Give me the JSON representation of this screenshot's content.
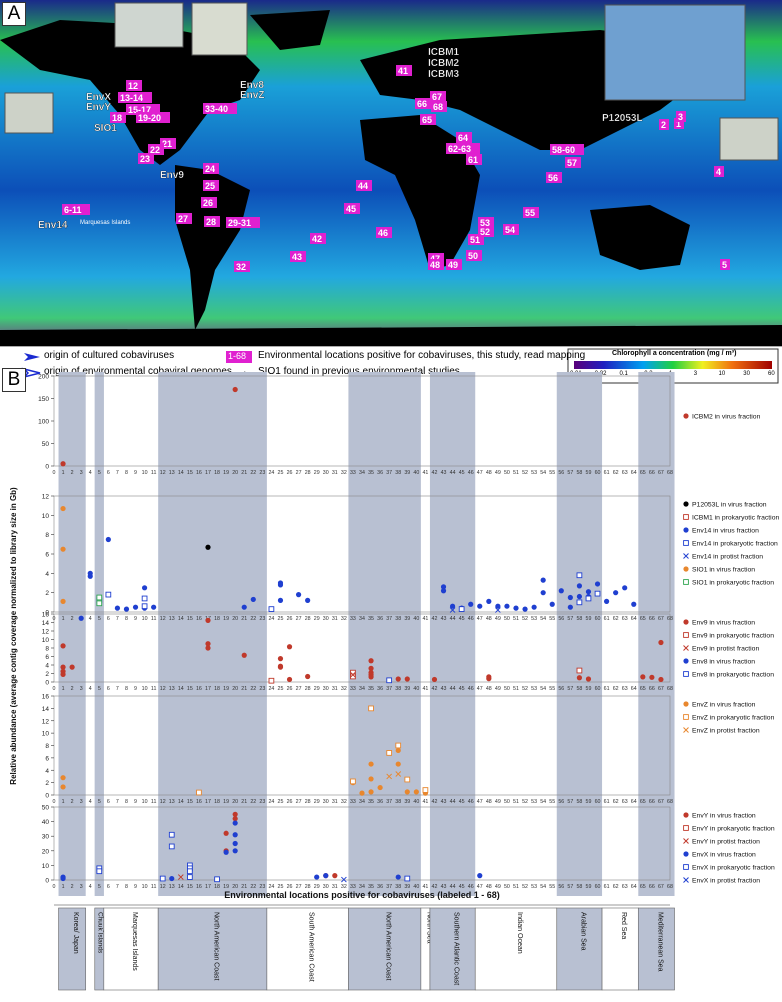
{
  "panel_a": {
    "letter": "A",
    "marine_islands_label": "Marquesas Islands",
    "site_labels": [
      {
        "text": "12"
      },
      {
        "text": "13-14"
      },
      {
        "text": "15-17"
      },
      {
        "text": "18"
      },
      {
        "text": "19-20"
      },
      {
        "text": "21"
      },
      {
        "text": "22"
      },
      {
        "text": "23"
      },
      {
        "text": "24"
      },
      {
        "text": "25"
      },
      {
        "text": "26"
      },
      {
        "text": "27"
      },
      {
        "text": "28"
      },
      {
        "text": "29-31"
      },
      {
        "text": "32"
      },
      {
        "text": "33-40"
      },
      {
        "text": "41"
      },
      {
        "text": "42"
      },
      {
        "text": "43"
      },
      {
        "text": "44"
      },
      {
        "text": "45"
      },
      {
        "text": "46"
      },
      {
        "text": "47"
      },
      {
        "text": "48"
      },
      {
        "text": "49"
      },
      {
        "text": "50"
      },
      {
        "text": "51"
      },
      {
        "text": "52"
      },
      {
        "text": "53"
      },
      {
        "text": "54"
      },
      {
        "text": "55"
      },
      {
        "text": "56"
      },
      {
        "text": "57"
      },
      {
        "text": "58-60"
      },
      {
        "text": "61"
      },
      {
        "text": "62-63"
      },
      {
        "text": "64"
      },
      {
        "text": "65"
      },
      {
        "text": "66"
      },
      {
        "text": "67"
      },
      {
        "text": "68"
      },
      {
        "text": "1"
      },
      {
        "text": "2"
      },
      {
        "text": "3"
      },
      {
        "text": "4"
      },
      {
        "text": "5"
      },
      {
        "text": "6-11"
      }
    ],
    "origin_labels": [
      {
        "text": "ICBM1"
      },
      {
        "text": "ICBM2"
      },
      {
        "text": "ICBM3"
      },
      {
        "text": "P12053L"
      },
      {
        "text": "EnvX"
      },
      {
        "text": "EnvY"
      },
      {
        "text": "SIO1"
      },
      {
        "text": "Env8"
      },
      {
        "text": "EnvZ"
      },
      {
        "text": "Env9"
      },
      {
        "text": "Env14"
      }
    ],
    "legend": {
      "cultured": "origin of cultured cobaviruses",
      "environmental": "origin of environmental cobaviral genomes",
      "range_badge": "1-68",
      "positive": "Environmental locations positive for cobaviruses, this study, read mapping",
      "sio1": "SIO1 found in previous environmental studies",
      "chl_title": "Chlorophyll a concentration  (mg / m³)",
      "chl_ticks": [
        "0.01",
        "0.02",
        "0.1",
        "0.3",
        "1",
        "3",
        "10",
        "30",
        "60"
      ]
    }
  },
  "panel_b": {
    "letter": "B",
    "y_axis_label": "Relative abundance (average contig coverage normalized to library size in Gb)",
    "x_axis_label": "Environmental locations positive for cobaviruses (labeled 1 - 68)",
    "regions": [
      {
        "label": "Korea/ Japan",
        "from": 0.5,
        "to": 3.5,
        "shaded": true
      },
      {
        "label": "Chuuk Islands",
        "from": 4.5,
        "to": 5.5,
        "shaded": true
      },
      {
        "label": "Sydney",
        "from": 4.5,
        "to": 5.5,
        "shaded": true
      },
      {
        "label": "Marquesas Islands",
        "from": 5.5,
        "to": 11.5,
        "shaded": false
      },
      {
        "label": "North American Coast",
        "from": 11.5,
        "to": 23.5,
        "shaded": true
      },
      {
        "label": "South American Coast",
        "from": 23.5,
        "to": 32.5,
        "shaded": false
      },
      {
        "label": "North American Coast",
        "from": 32.5,
        "to": 40.5,
        "shaded": true
      },
      {
        "label": "North Sea",
        "from": 40.5,
        "to": 41.5,
        "shaded": false
      },
      {
        "label": "Southern Atlantic Coast",
        "from": 41.5,
        "to": 46.5,
        "shaded": true
      },
      {
        "label": "Indian Ocean",
        "from": 46.5,
        "to": 55.5,
        "shaded": false
      },
      {
        "label": "Arabian Sea",
        "from": 55.5,
        "to": 60.5,
        "shaded": true
      },
      {
        "label": "Red Sea",
        "from": 60.5,
        "to": 64.5,
        "shaded": false
      },
      {
        "label": "Mediterranean Sea",
        "from": 64.5,
        "to": 68.5,
        "shaded": true
      }
    ]
  },
  "chart_data": [
    {
      "type": "scatter",
      "xlim": [
        0,
        68
      ],
      "ylim": [
        0,
        200
      ],
      "yticks": [
        0,
        50,
        100,
        150,
        200
      ],
      "series": [
        {
          "name": "ICBM2 in virus fraction",
          "color": "#c0392b",
          "marker": "dot",
          "points": [
            [
              1,
              5
            ],
            [
              20,
              170
            ]
          ]
        }
      ]
    },
    {
      "type": "scatter",
      "xlim": [
        0,
        68
      ],
      "ylim": [
        0,
        12
      ],
      "yticks": [
        0,
        2,
        4,
        6,
        8,
        10,
        12
      ],
      "series": [
        {
          "name": "P12053L in virus fraction",
          "color": "#000000",
          "marker": "dot",
          "points": [
            [
              17,
              6.7
            ]
          ]
        },
        {
          "name": "ICBM1 in prokaryotic fraction",
          "color": "#c0392b",
          "marker": "square",
          "points": []
        },
        {
          "name": "Env14 in virus fraction",
          "color": "#1f3fd0",
          "marker": "dot",
          "points": [
            [
              4,
              4
            ],
            [
              4,
              3.7
            ],
            [
              6,
              7.5
            ],
            [
              7,
              0.4
            ],
            [
              8,
              0.3
            ],
            [
              9,
              0.5
            ],
            [
              10,
              2.5
            ],
            [
              10,
              0.4
            ],
            [
              11,
              0.5
            ],
            [
              21,
              0.5
            ],
            [
              22,
              1.3
            ],
            [
              25,
              3
            ],
            [
              25,
              2.8
            ],
            [
              25,
              1.2
            ],
            [
              27,
              1.8
            ],
            [
              28,
              1.2
            ],
            [
              43,
              2.6
            ],
            [
              43,
              2.2
            ],
            [
              44,
              0.6
            ],
            [
              45,
              0.4
            ],
            [
              46,
              0.8
            ],
            [
              47,
              0.6
            ],
            [
              48,
              1.1
            ],
            [
              49,
              0.6
            ],
            [
              50,
              0.6
            ],
            [
              51,
              0.4
            ],
            [
              52,
              0.3
            ],
            [
              53,
              0.5
            ],
            [
              54,
              3.3
            ],
            [
              54,
              2
            ],
            [
              55,
              0.8
            ],
            [
              56,
              2.2
            ],
            [
              57,
              0.5
            ],
            [
              57,
              1.5
            ],
            [
              58,
              2.7
            ],
            [
              58,
              1.6
            ],
            [
              59,
              2.1
            ],
            [
              59,
              1.6
            ],
            [
              60,
              2.9
            ],
            [
              61,
              1.1
            ],
            [
              62,
              2
            ],
            [
              63,
              2.5
            ],
            [
              64,
              0.8
            ]
          ]
        },
        {
          "name": "Env14 in prokaryotic fraction",
          "color": "#1f3fd0",
          "marker": "square",
          "points": [
            [
              5,
              1.2
            ],
            [
              6,
              1.8
            ],
            [
              10,
              1.4
            ],
            [
              10,
              0.6
            ],
            [
              24,
              0.3
            ],
            [
              45,
              0.3
            ],
            [
              58,
              3.8
            ],
            [
              58,
              1
            ],
            [
              59,
              1.4
            ],
            [
              60,
              1.9
            ]
          ]
        },
        {
          "name": "Env14 in protist fraction",
          "color": "#1f3fd0",
          "marker": "x",
          "points": [
            [
              44,
              0.2
            ],
            [
              49,
              0.2
            ]
          ]
        },
        {
          "name": "SIO1 in virus fraction",
          "color": "#e8872e",
          "marker": "dot",
          "points": [
            [
              1,
              10.7
            ],
            [
              1,
              6.5
            ],
            [
              1,
              1.1
            ]
          ]
        },
        {
          "name": "SIO1 in prokaryotic fraction",
          "color": "#2ea44f",
          "marker": "square",
          "points": [
            [
              5,
              1.5
            ],
            [
              5,
              0.9
            ]
          ]
        }
      ]
    },
    {
      "type": "scatter",
      "xlim": [
        0,
        68
      ],
      "ylim": [
        0,
        16
      ],
      "yticks": [
        0,
        2,
        4,
        6,
        8,
        10,
        12,
        14,
        16
      ],
      "series": [
        {
          "name": "Env9 in virus fraction",
          "color": "#c0392b",
          "marker": "dot",
          "points": [
            [
              1,
              8.5
            ],
            [
              1,
              3.5
            ],
            [
              1,
              2.5
            ],
            [
              1,
              1.8
            ],
            [
              2,
              3.5
            ],
            [
              17,
              14.5
            ],
            [
              17,
              9
            ],
            [
              17,
              8
            ],
            [
              21,
              6.3
            ],
            [
              25,
              5.5
            ],
            [
              25,
              3.7
            ],
            [
              25,
              3.5
            ],
            [
              26,
              8.3
            ],
            [
              26,
              0.6
            ],
            [
              28,
              1.3
            ],
            [
              35,
              5
            ],
            [
              35,
              3.2
            ],
            [
              35,
              2.2
            ],
            [
              35,
              1.7
            ],
            [
              35,
              1.2
            ],
            [
              38,
              0.7
            ],
            [
              39,
              0.7
            ],
            [
              42,
              0.6
            ],
            [
              48,
              1.2
            ],
            [
              48,
              0.8
            ],
            [
              58,
              1
            ],
            [
              59,
              0.7
            ],
            [
              65,
              1.2
            ],
            [
              66,
              1.1
            ],
            [
              67,
              9.3
            ],
            [
              67,
              0.6
            ]
          ]
        },
        {
          "name": "Env9 in prokaryotic fraction",
          "color": "#c0392b",
          "marker": "square",
          "points": [
            [
              24,
              0.3
            ],
            [
              33,
              2.2
            ],
            [
              33,
              1.3
            ],
            [
              58,
              2.7
            ]
          ]
        },
        {
          "name": "Env9 in protist fraction",
          "color": "#c0392b",
          "marker": "x",
          "points": [
            [
              33,
              1.7
            ]
          ]
        },
        {
          "name": "Env8 in virus fraction",
          "color": "#1f3fd0",
          "marker": "dot",
          "points": [
            [
              3,
              15
            ]
          ]
        },
        {
          "name": "Env8 in prokaryotic fraction",
          "color": "#1f3fd0",
          "marker": "square",
          "points": [
            [
              37,
              0.4
            ]
          ]
        }
      ]
    },
    {
      "type": "scatter",
      "xlim": [
        0,
        68
      ],
      "ylim": [
        0,
        16
      ],
      "yticks": [
        0,
        2,
        4,
        6,
        8,
        10,
        12,
        14,
        16
      ],
      "series": [
        {
          "name": "EnvZ in virus fraction",
          "color": "#e8872e",
          "marker": "dot",
          "points": [
            [
              1,
              2.8
            ],
            [
              1,
              1.3
            ],
            [
              33,
              2
            ],
            [
              34,
              0.3
            ],
            [
              35,
              5
            ],
            [
              35,
              2.6
            ],
            [
              35,
              0.5
            ],
            [
              36,
              1.2
            ],
            [
              38,
              7.2
            ],
            [
              38,
              5
            ],
            [
              39,
              0.5
            ],
            [
              40,
              0.5
            ],
            [
              41,
              0.5
            ],
            [
              41,
              0.3
            ]
          ]
        },
        {
          "name": "EnvZ in prokaryotic fraction",
          "color": "#e8872e",
          "marker": "square",
          "points": [
            [
              16,
              0.4
            ],
            [
              33,
              2.2
            ],
            [
              35,
              14
            ],
            [
              37,
              6.8
            ],
            [
              38,
              8
            ],
            [
              39,
              2.5
            ],
            [
              41,
              0.8
            ]
          ]
        },
        {
          "name": "EnvZ in protist fraction",
          "color": "#e8872e",
          "marker": "x",
          "points": [
            [
              37,
              3
            ],
            [
              38,
              3.4
            ]
          ]
        }
      ]
    },
    {
      "type": "scatter",
      "xlim": [
        0,
        68
      ],
      "ylim": [
        0,
        50
      ],
      "yticks": [
        0,
        10,
        20,
        30,
        40,
        50
      ],
      "series": [
        {
          "name": "EnvY in virus fraction",
          "color": "#c0392b",
          "marker": "dot",
          "points": [
            [
              19,
              32
            ],
            [
              19,
              20
            ],
            [
              20,
              45
            ],
            [
              20,
              42
            ],
            [
              30,
              3
            ],
            [
              31,
              3
            ]
          ]
        },
        {
          "name": "EnvY in prokaryotic fraction",
          "color": "#c0392b",
          "marker": "square",
          "points": []
        },
        {
          "name": "EnvY in protist fraction",
          "color": "#c0392b",
          "marker": "x",
          "points": [
            [
              14,
              2
            ]
          ]
        },
        {
          "name": "EnvX in virus fraction",
          "color": "#1f3fd0",
          "marker": "dot",
          "points": [
            [
              1,
              2
            ],
            [
              1,
              1
            ],
            [
              13,
              1
            ],
            [
              15,
              2
            ],
            [
              19,
              19
            ],
            [
              20,
              39
            ],
            [
              20,
              31
            ],
            [
              20,
              25
            ],
            [
              20,
              20
            ],
            [
              29,
              2
            ],
            [
              30,
              3
            ],
            [
              38,
              2
            ],
            [
              47,
              3
            ]
          ]
        },
        {
          "name": "EnvX in prokaryotic fraction",
          "color": "#1f3fd0",
          "marker": "square",
          "points": [
            [
              5,
              8
            ],
            [
              5,
              6
            ],
            [
              12,
              1
            ],
            [
              13,
              31
            ],
            [
              13,
              23
            ],
            [
              15,
              10
            ],
            [
              15,
              8
            ],
            [
              15,
              6
            ],
            [
              15,
              2
            ],
            [
              18,
              0.5
            ],
            [
              39,
              1
            ]
          ]
        },
        {
          "name": "EnvX in protist fraction",
          "color": "#1f3fd0",
          "marker": "x",
          "points": [
            [
              32,
              0.3
            ]
          ]
        }
      ]
    }
  ]
}
